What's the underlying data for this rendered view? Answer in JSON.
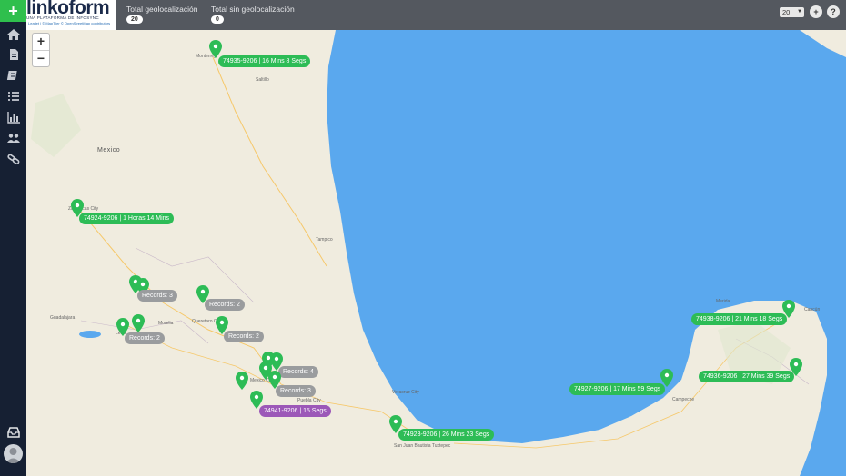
{
  "app": {
    "logo_text": "linkoform",
    "logo_subtitle": "UNA PLATAFORMA DE INFOSYNC",
    "logo_attribution": "Leaflet | © MapTiler © OpenStreetMap contributors"
  },
  "header": {
    "total_geo_label": "Total geolocalización",
    "total_geo_value": "20",
    "total_no_geo_label": "Total sin geolocalización",
    "total_no_geo_value": "0",
    "page_size": "20",
    "add_label": "+",
    "help_label": "?"
  },
  "sidebar": {
    "add_label": "+",
    "items": [
      "home-icon",
      "document-icon",
      "forms-icon",
      "list-icon",
      "chart-icon",
      "users-icon",
      "link-icon"
    ]
  },
  "map": {
    "zoom_in": "+",
    "zoom_out": "−",
    "country_label": "Mexico",
    "places": [
      "Monterrey",
      "Saltillo",
      "Zacatecas City",
      "Tampico",
      "Guadalajara",
      "Queretaro City",
      "Mexico City",
      "Puebla City",
      "Veracruz City",
      "Merida",
      "Campeche",
      "San Juan Bautista Tuxtepec",
      "Cancún",
      "Leon",
      "Morelia"
    ],
    "markers": [
      {
        "label": "74935-9206 | 16 Mins 8 Segs",
        "style": "green"
      },
      {
        "label": "74924-9206 | 1 Horas 14 Mins",
        "style": "green"
      },
      {
        "label": "Records: 3",
        "style": "gray"
      },
      {
        "label": "Records: 2",
        "style": "gray"
      },
      {
        "label": "Records: 2",
        "style": "gray"
      },
      {
        "label": "Records: 2",
        "style": "gray"
      },
      {
        "label": "Records: 4",
        "style": "gray"
      },
      {
        "label": "Records: 3",
        "style": "gray"
      },
      {
        "label": "74941-9206 | 15 Segs",
        "style": "purple"
      },
      {
        "label": "74923-9206 | 26 Mins 23 Segs",
        "style": "green"
      },
      {
        "label": "74927-9206 | 17 Mins 59 Segs",
        "style": "green"
      },
      {
        "label": "74938-9206 | 21 Mins 18 Segs",
        "style": "green"
      },
      {
        "label": "74936-9206 | 27 Mins 39 Segs",
        "style": "green"
      }
    ]
  },
  "colors": {
    "sidebar_bg": "#162033",
    "accent_green": "#2fbf4d",
    "topbar_bg": "#54585f",
    "sea": "#5aa8ee",
    "land": "#f0ecdf"
  }
}
